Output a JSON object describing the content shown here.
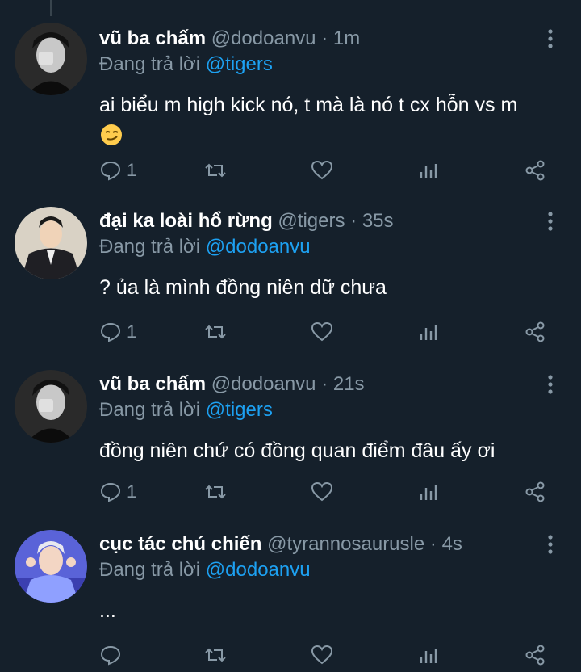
{
  "reply_prefix": "Đang trả lời",
  "tweets": [
    {
      "name": "vũ ba chấm",
      "handle": "@dodoanvu",
      "separator": "·",
      "time": "1m",
      "reply_to": "@tigers",
      "text": "ai biểu m high kick nó, t mà là nó t cx hỗn vs m",
      "emoji": "smirking-face",
      "reply_count": "1",
      "avatar": "bw-portrait"
    },
    {
      "name": "đại ka loài hổ rừng",
      "handle": "@tigers",
      "separator": "·",
      "time": "35s",
      "reply_to": "@dodoanvu",
      "text": "? ủa là mình đồng niên dữ chưa",
      "reply_count": "1",
      "avatar": "suit-portrait"
    },
    {
      "name": "vũ ba chấm",
      "handle": "@dodoanvu",
      "separator": "·",
      "time": "21s",
      "reply_to": "@tigers",
      "text": "đồng niên chứ có đồng quan điểm đâu ấy ơi",
      "reply_count": "1",
      "avatar": "bw-portrait"
    },
    {
      "name": "cục tác chú chiến",
      "handle": "@tyrannosaurusle",
      "separator": "·",
      "time": "4s",
      "reply_to": "@dodoanvu",
      "text": "...",
      "reply_count": "",
      "avatar": "blue-portrait"
    }
  ],
  "colors": {
    "background": "#15202b",
    "secondary_text": "#8899a6",
    "mention": "#1da1f2"
  }
}
